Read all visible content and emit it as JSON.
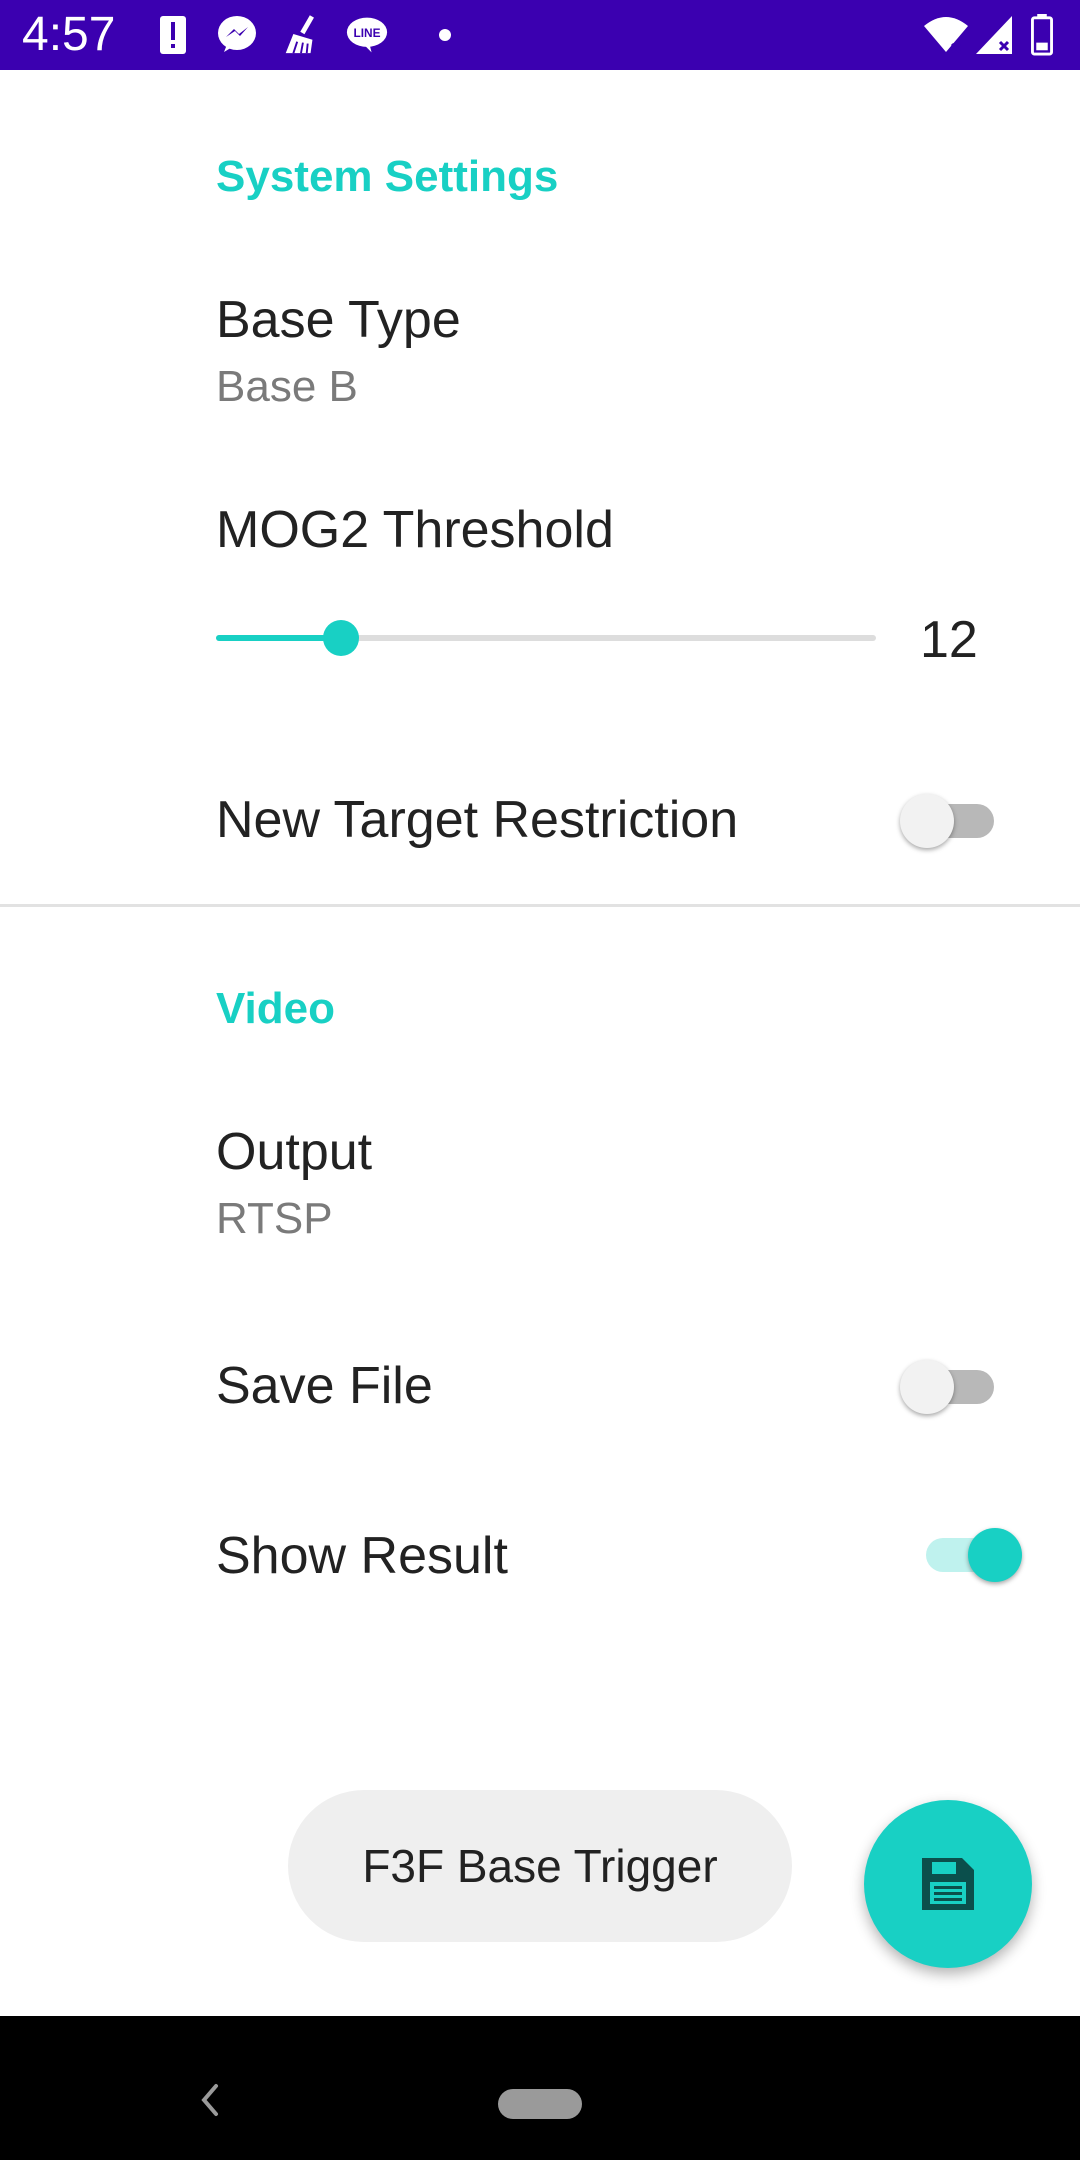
{
  "status_bar": {
    "time": "4:57",
    "icons_left": [
      "alert-icon",
      "messenger-icon",
      "cleaner-icon",
      "line-icon",
      "dot-icon"
    ],
    "line_icon_text": "LINE",
    "icons_right": [
      "wifi-icon",
      "signal-icon",
      "battery-icon"
    ]
  },
  "sections": {
    "system": {
      "header": "System Settings",
      "base_type": {
        "title": "Base Type",
        "summary": "Base B"
      },
      "mog2": {
        "title": "MOG2 Threshold",
        "value": "12",
        "fraction": 0.19
      },
      "new_target": {
        "title": "New Target Restriction",
        "checked": false
      }
    },
    "video": {
      "header": "Video",
      "output": {
        "title": "Output",
        "summary": "RTSP"
      },
      "save_file": {
        "title": "Save File",
        "checked": false
      },
      "show_result": {
        "title": "Show Result",
        "checked": true
      }
    }
  },
  "buttons": {
    "trigger_label": "F3F Base Trigger",
    "fab_icon": "save-icon"
  },
  "colors": {
    "accent": "#18d0c4",
    "status_bar": "#3b00b0"
  },
  "nav_bar": {
    "icons": [
      "back-icon",
      "home-icon"
    ]
  }
}
